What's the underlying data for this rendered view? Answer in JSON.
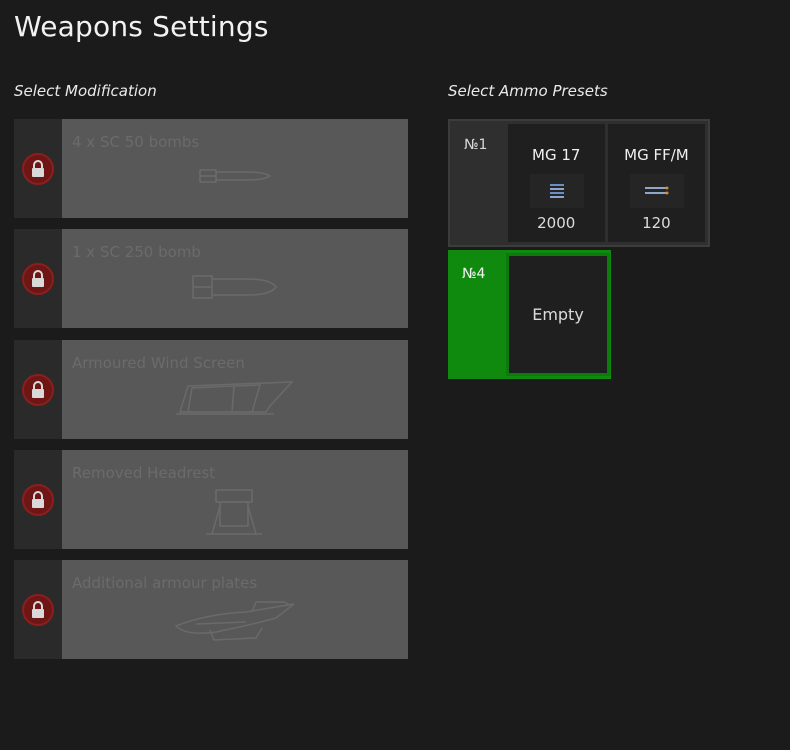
{
  "title": "Weapons Settings",
  "modifications": {
    "label": "Select Modification",
    "items": [
      {
        "name": "4 x SC 50 bombs",
        "locked": true
      },
      {
        "name": "1 x SC 250 bomb",
        "locked": true
      },
      {
        "name": "Armoured Wind Screen",
        "locked": true
      },
      {
        "name": "Removed Headrest",
        "locked": true
      },
      {
        "name": "Additional armour plates",
        "locked": true
      }
    ]
  },
  "presets": {
    "label": "Select Ammo Presets",
    "items": [
      {
        "number": "№1",
        "slots": [
          {
            "name": "MG 17",
            "count": "2000",
            "icon": "ammo-belt-icon"
          },
          {
            "name": "MG FF/M",
            "count": "120",
            "icon": "ammo-belt-icon"
          }
        ]
      },
      {
        "number": "№4",
        "selected": true,
        "empty_label": "Empty"
      }
    ]
  },
  "colors": {
    "background": "#1b1b1b",
    "selected_green": "#0f8a0f",
    "lock_red": "#6e1616"
  }
}
